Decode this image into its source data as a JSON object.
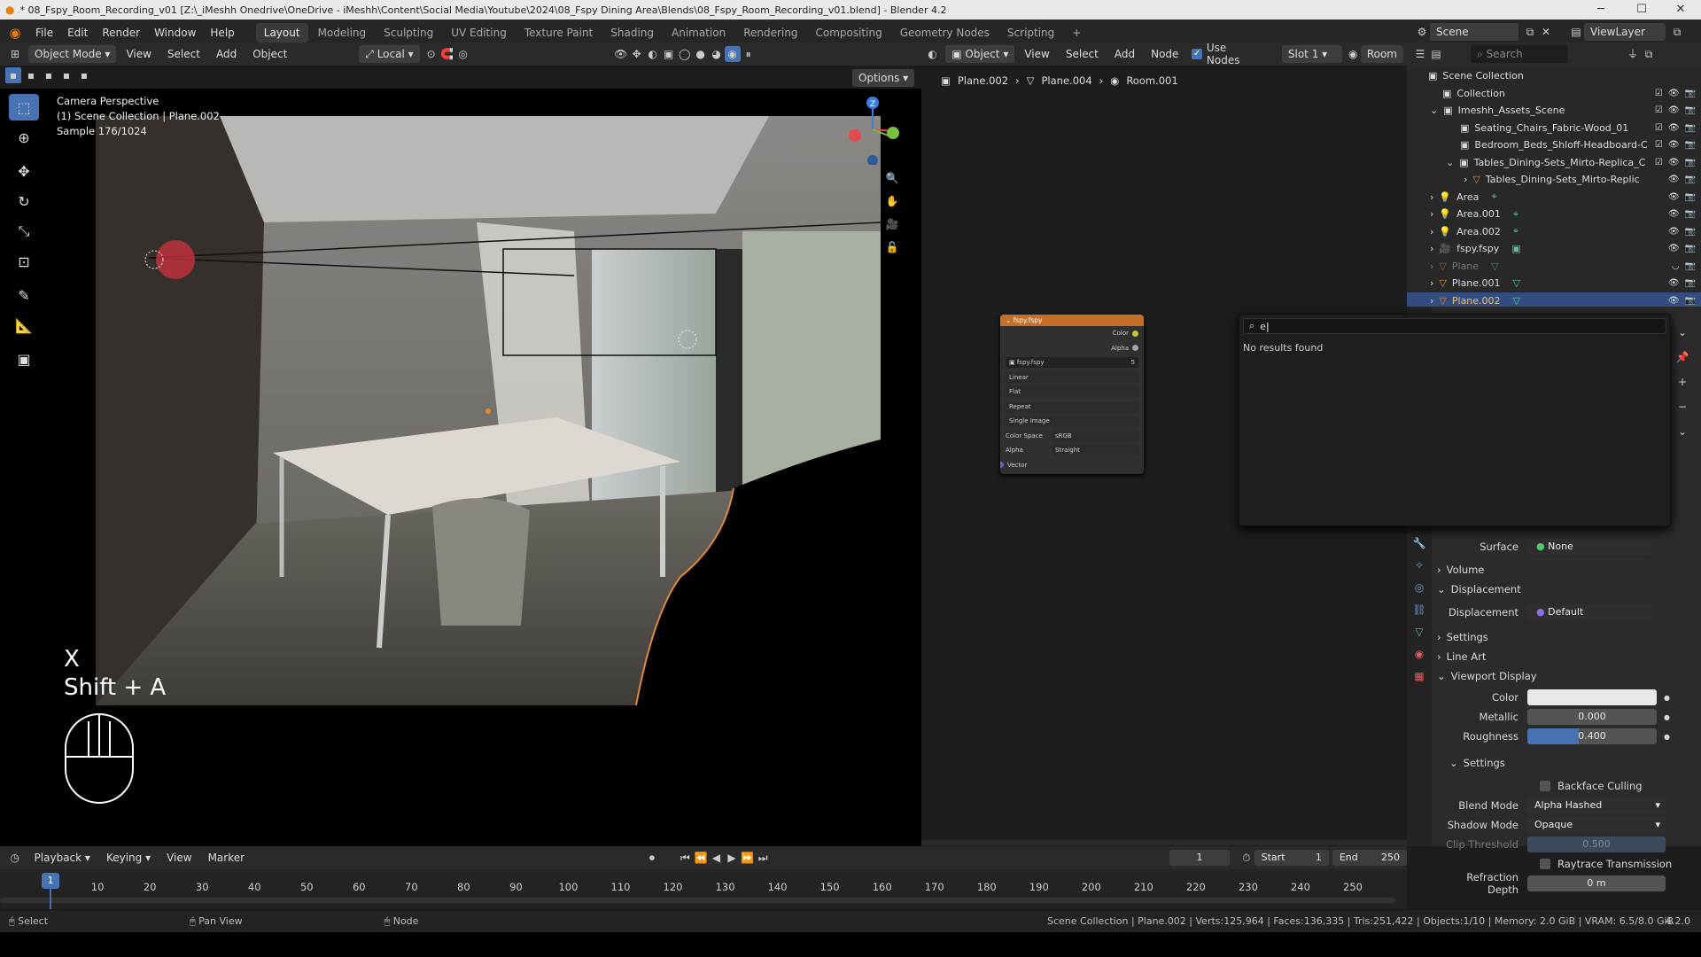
{
  "window": {
    "title": "* 08_Fspy_Room_Recording_v01 [Z:\\_iMeshh Onedrive\\OneDrive - iMeshh\\Content\\Social Media\\Youtube\\2024\\08_Fspy Dining Area\\Blends\\08_Fspy_Room_Recording_v01.blend] - Blender 4.2"
  },
  "menubar": {
    "menus": [
      "File",
      "Edit",
      "Render",
      "Window",
      "Help"
    ],
    "workspaces": [
      "Layout",
      "Modeling",
      "Sculpting",
      "UV Editing",
      "Texture Paint",
      "Shading",
      "Animation",
      "Rendering",
      "Compositing",
      "Geometry Nodes",
      "Scripting"
    ],
    "active_workspace": "Layout",
    "scene": "Scene",
    "view_layer": "ViewLayer"
  },
  "viewport": {
    "mode": "Object Mode",
    "menus": [
      "View",
      "Select",
      "Add",
      "Object"
    ],
    "orientation": "Local",
    "options": "Options",
    "overlay_title": "Camera Perspective",
    "overlay_collection": "(1) Scene Collection | Plane.002",
    "overlay_sample": "Sample 176/1024",
    "keys": [
      "X",
      "Shift + A"
    ]
  },
  "node_editor": {
    "type": "Object",
    "menus": [
      "View",
      "Select",
      "Add",
      "Node"
    ],
    "use_nodes": "Use Nodes",
    "slot": "Slot 1",
    "material": "Room",
    "breadcrumbs": [
      "Plane.002",
      "Plane.004",
      "Room.001"
    ],
    "node": {
      "title": "fspy.fspy",
      "outputs": [
        "Color",
        "Alpha"
      ],
      "image": "fspy.fspy",
      "users": "5",
      "interpolation": "Linear",
      "projection": "Flat",
      "extension": "Repeat",
      "source": "Single Image",
      "color_space_label": "Color Space",
      "color_space": "sRGB",
      "alpha_label": "Alpha",
      "alpha": "Straight",
      "input": "Vector"
    }
  },
  "outliner": {
    "search_placeholder": "Search",
    "items": [
      {
        "label": "Scene Collection",
        "indent": 0
      },
      {
        "label": "Collection",
        "indent": 1
      },
      {
        "label": "Imeshh_Assets_Scene",
        "indent": 1
      },
      {
        "label": "Seating_Chairs_Fabric-Wood_01",
        "indent": 2
      },
      {
        "label": "Bedroom_Beds_Shloff-Headboard-C",
        "indent": 2
      },
      {
        "label": "Tables_Dining-Sets_Mirto-Replica_C",
        "indent": 2
      },
      {
        "label": "Tables_Dining-Sets_Mirto-Replic",
        "indent": 3
      },
      {
        "label": "Area",
        "indent": 1
      },
      {
        "label": "Area.001",
        "indent": 1
      },
      {
        "label": "Area.002",
        "indent": 1
      },
      {
        "label": "fspy.fspy",
        "indent": 1
      },
      {
        "label": "Plane",
        "indent": 1
      },
      {
        "label": "Plane.001",
        "indent": 1
      },
      {
        "label": "Plane.002",
        "indent": 1
      }
    ]
  },
  "search_popup": {
    "query": "e",
    "message": "No results found"
  },
  "properties": {
    "surface_label": "Surface",
    "surface_value": "None",
    "volume": "Volume",
    "displacement_panel": "Displacement",
    "displacement_label": "Displacement",
    "displacement_value": "Default",
    "settings": "Settings",
    "line_art": "Line Art",
    "viewport_display": "Viewport Display",
    "color_label": "Color",
    "metallic_label": "Metallic",
    "metallic_value": "0.000",
    "roughness_label": "Roughness",
    "roughness_value": "0.400",
    "roughness_fraction": 0.4,
    "settings_sub": "Settings",
    "backface_culling": "Backface Culling",
    "blend_mode_label": "Blend Mode",
    "blend_mode": "Alpha Hashed",
    "shadow_mode_label": "Shadow Mode",
    "shadow_mode": "Opaque",
    "clip_threshold_label": "Clip Threshold",
    "clip_threshold": "0.500",
    "raytrace_transmission": "Raytrace Transmission",
    "refraction_depth_label": "Refraction Depth",
    "refraction_depth": "0 m",
    "viewport_color": "#e8e8e8"
  },
  "timeline": {
    "menus": [
      "Playback",
      "Keying",
      "View",
      "Marker"
    ],
    "current_frame": "1",
    "start_label": "Start",
    "start": "1",
    "end_label": "End",
    "end": "250",
    "ticks": [
      "1",
      "10",
      "20",
      "30",
      "40",
      "50",
      "60",
      "70",
      "80",
      "90",
      "100",
      "110",
      "120",
      "130",
      "140",
      "150",
      "160",
      "170",
      "180",
      "190",
      "200",
      "210",
      "220",
      "230",
      "240",
      "250"
    ]
  },
  "statusbar": {
    "left": [
      "Select",
      "Pan View",
      "Node"
    ],
    "info": "Scene Collection | Plane.002 | Verts:125,964 | Faces:136,335 | Tris:251,422 | Objects:1/10 | Memory: 2.0 GiB | VRAM: 6.5/8.0 GiB",
    "version": "4.2.0"
  },
  "colors": {
    "accent": "#4772b3",
    "node_header": "#c4702b",
    "selected_row": "#334d80"
  }
}
